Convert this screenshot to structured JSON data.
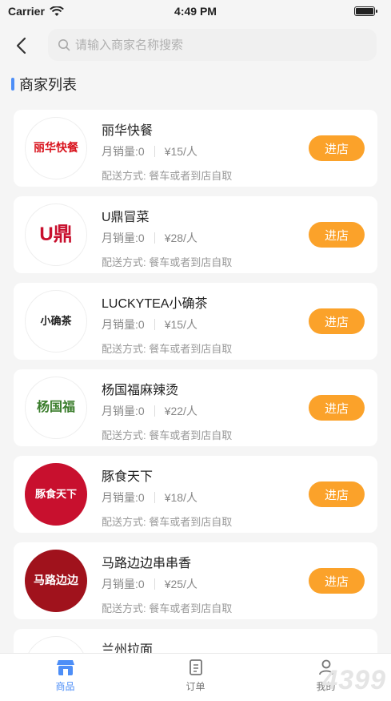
{
  "status_bar": {
    "carrier": "Carrier",
    "time": "4:49 PM"
  },
  "search": {
    "placeholder": "请输入商家名称搜索"
  },
  "section": {
    "title": "商家列表"
  },
  "colors": {
    "accent": "#fba22a",
    "tab_active": "#4d8ef7",
    "title_bar": "#4d8ef7"
  },
  "shops": [
    {
      "name": "丽华快餐",
      "sales": "月销量:0",
      "price": "¥15/人",
      "delivery": "配送方式: 餐车或者到店自取",
      "button": "进店",
      "logo_text": "丽华快餐",
      "logo_color": "#d9141e"
    },
    {
      "name": "U鼎冒菜",
      "sales": "月销量:0",
      "price": "¥28/人",
      "delivery": "配送方式: 餐车或者到店自取",
      "button": "进店",
      "logo_text": "U鼎",
      "logo_color": "#c8102e"
    },
    {
      "name": "LUCKYTEA小确茶",
      "sales": "月销量:0",
      "price": "¥15/人",
      "delivery": "配送方式: 餐车或者到店自取",
      "button": "进店",
      "logo_text": "小确茶",
      "logo_color": "#222222"
    },
    {
      "name": "杨国福麻辣烫",
      "sales": "月销量:0",
      "price": "¥22/人",
      "delivery": "配送方式: 餐车或者到店自取",
      "button": "进店",
      "logo_text": "杨国福",
      "logo_color": "#3a7d2c"
    },
    {
      "name": "豚食天下",
      "sales": "月销量:0",
      "price": "¥18/人",
      "delivery": "配送方式: 餐车或者到店自取",
      "button": "进店",
      "logo_text": "豚食天下",
      "logo_color": "#c8102e"
    },
    {
      "name": "马路边边串串香",
      "sales": "月销量:0",
      "price": "¥25/人",
      "delivery": "配送方式: 餐车或者到店自取",
      "button": "进店",
      "logo_text": "马路边边",
      "logo_color": "#a0121c"
    },
    {
      "name": "兰州拉面"
    }
  ],
  "tabs": [
    {
      "label": "商品",
      "icon": "shop-icon",
      "active": true
    },
    {
      "label": "订单",
      "icon": "order-icon",
      "active": false
    },
    {
      "label": "我的",
      "icon": "user-icon",
      "active": false
    }
  ],
  "watermark": "4399"
}
